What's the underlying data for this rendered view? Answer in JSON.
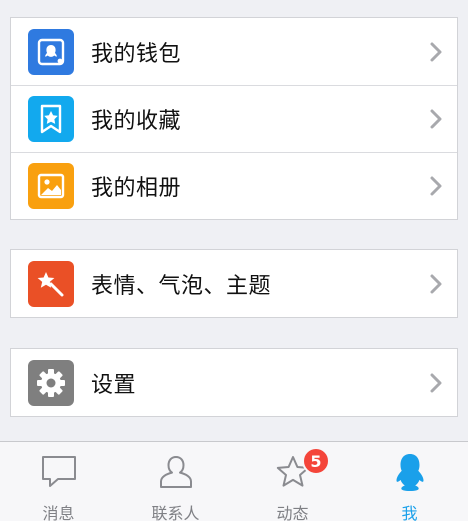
{
  "menu": {
    "wallet": {
      "label": "我的钱包",
      "icon": "wallet-icon",
      "color": "#2f7ae0"
    },
    "favorites": {
      "label": "我的收藏",
      "icon": "favorites-star-icon",
      "color": "#12a9ee"
    },
    "album": {
      "label": "我的相册",
      "icon": "photo-album-icon",
      "color": "#f9a00f"
    },
    "themes": {
      "label": "表情、气泡、主题",
      "icon": "magic-wand-icon",
      "color": "#ea5026"
    },
    "settings": {
      "label": "设置",
      "icon": "gear-icon",
      "color": "#7f7f7f"
    }
  },
  "tabbar": {
    "messages": {
      "label": "消息",
      "icon": "chat-bubble-icon"
    },
    "contacts": {
      "label": "联系人",
      "icon": "person-icon"
    },
    "moments": {
      "label": "动态",
      "icon": "star-icon",
      "badge": "5"
    },
    "me": {
      "label": "我",
      "icon": "penguin-icon",
      "active": true
    }
  },
  "colors": {
    "accent": "#1aa0ea",
    "badge": "#f4453a",
    "background": "#eff0f4"
  }
}
